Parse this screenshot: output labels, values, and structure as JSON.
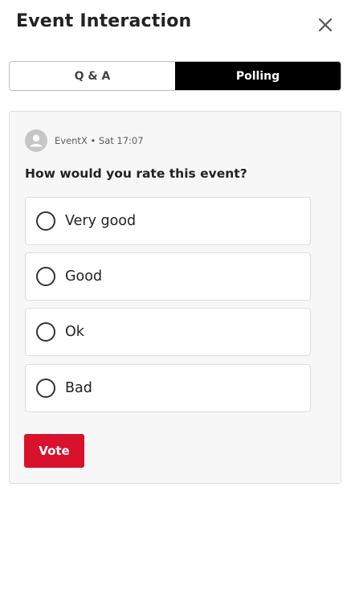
{
  "header": {
    "title": "Event Interaction",
    "close_icon": "close-icon"
  },
  "tabs": [
    {
      "label": "Q & A",
      "active": false
    },
    {
      "label": "Polling",
      "active": true
    }
  ],
  "poll": {
    "author": "EventX",
    "timestamp": "Sat 17:07",
    "meta": "EventX • Sat 17:07",
    "question": "How would you rate this event?",
    "options": [
      {
        "label": "Very good",
        "selected": false
      },
      {
        "label": "Good",
        "selected": false
      },
      {
        "label": "Ok",
        "selected": false
      },
      {
        "label": "Bad",
        "selected": false
      }
    ],
    "vote_label": "Vote"
  },
  "colors": {
    "accent": "#d8112d",
    "active_tab": "#000000",
    "card_bg": "#f7f7f7"
  }
}
